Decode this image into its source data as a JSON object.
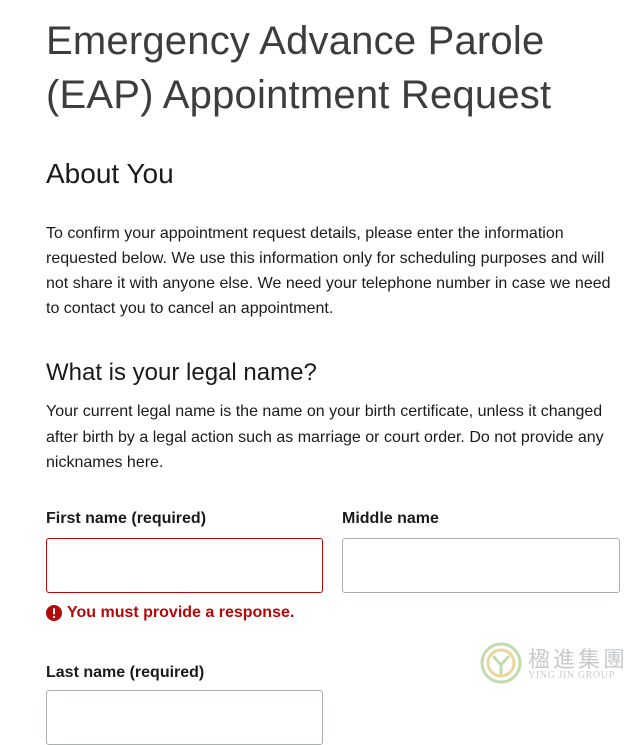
{
  "page": {
    "title": "Emergency Advance Parole (EAP) Appointment Request"
  },
  "about_section": {
    "heading": "About You",
    "intro": "To confirm your appointment request details, please enter the information requested below. We use this information only for scheduling purposes and will not share it with anyone else. We need your telephone number in case we need to contact you to cancel an appointment."
  },
  "legal_name": {
    "question": "What is your legal name?",
    "hint": "Your current legal name is the name on your birth certificate, unless it changed after birth by a legal action such as marriage or court order. Do not provide any nicknames here.",
    "first_name": {
      "label": "First name (required)",
      "value": "",
      "error": "You must provide a response."
    },
    "middle_name": {
      "label": "Middle name",
      "value": ""
    },
    "last_name": {
      "label": "Last name (required)",
      "value": ""
    }
  },
  "colors": {
    "error": "#b50909",
    "input_border": "#a9aeb1",
    "text": "#1b1b1b"
  },
  "watermark": {
    "cn": "楹進集團",
    "en": "YING JIN GROUP"
  }
}
